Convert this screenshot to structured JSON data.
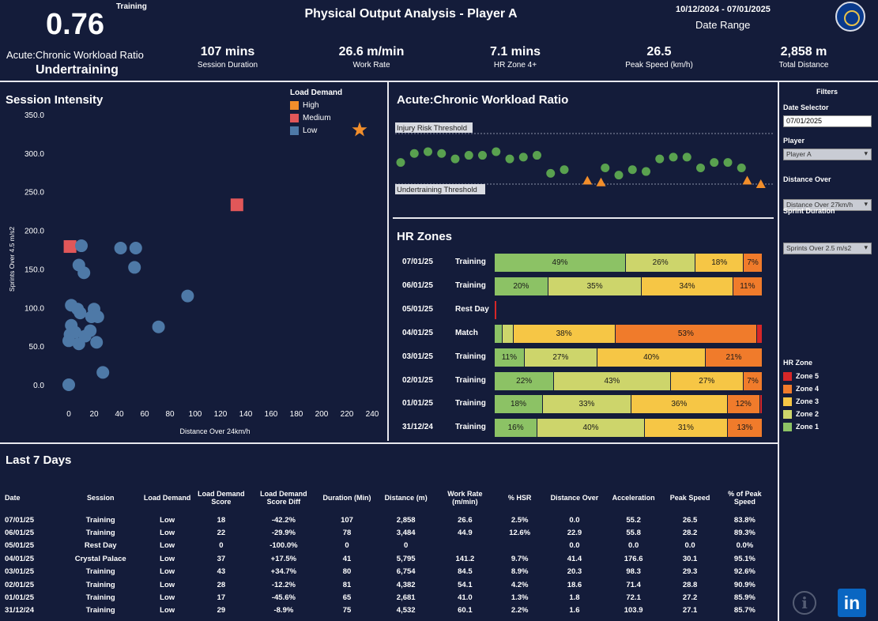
{
  "header": {
    "acwr_value": "0.76",
    "acwr_session": "Training",
    "acwr_label": "Acute:Chronic Workload Ratio",
    "acwr_status": "Undertraining",
    "title": "Physical Output Analysis - Player A",
    "date_range": "10/12/2024 - 07/01/2025",
    "date_range_label": "Date Range",
    "kpis": [
      {
        "value": "107 mins",
        "label": "Session Duration"
      },
      {
        "value": "26.6 m/min",
        "label": "Work Rate"
      },
      {
        "value": "7.1 mins",
        "label": "HR Zone 4+"
      },
      {
        "value": "26.5",
        "label": "Peak Speed (km/h)"
      },
      {
        "value": "2,858 m",
        "label": "Total Distance"
      }
    ]
  },
  "session_intensity": {
    "title": "Session Intensity",
    "legend_title": "Load Demand",
    "legend": [
      {
        "label": "High",
        "color": "#f28e2b"
      },
      {
        "label": "Medium",
        "color": "#e15759"
      },
      {
        "label": "Low",
        "color": "#4e79a7"
      }
    ]
  },
  "chart_data": [
    {
      "type": "scatter",
      "title": "Session Intensity",
      "xlabel": "Distance Over 24km/h",
      "ylabel": "Sprints Over 4.5 m/s2",
      "xlim": [
        -5,
        240
      ],
      "ylim": [
        -10,
        360
      ],
      "x_ticks": [
        "0",
        "20",
        "40",
        "60",
        "80",
        "100",
        "120",
        "140",
        "160",
        "180",
        "200",
        "220",
        "240"
      ],
      "y_ticks": [
        "0.0",
        "50.0",
        "100.0",
        "150.0",
        "200.0",
        "250.0",
        "300.0",
        "350.0"
      ],
      "series": [
        {
          "name": "High",
          "color": "#f28e2b",
          "marker": "star",
          "points": [
            [
              230,
              330
            ]
          ]
        },
        {
          "name": "Medium",
          "color": "#e15759",
          "marker": "square",
          "points": [
            [
              133,
              233
            ],
            [
              1,
              179
            ]
          ]
        },
        {
          "name": "Low",
          "color": "#4e79a7",
          "marker": "circle",
          "points": [
            [
              10,
              180
            ],
            [
              41,
              177
            ],
            [
              53,
              177
            ],
            [
              8,
              155
            ],
            [
              12,
              145
            ],
            [
              52,
              152
            ],
            [
              94,
              115
            ],
            [
              2,
              103
            ],
            [
              7,
              98
            ],
            [
              20,
              98
            ],
            [
              9,
              93
            ],
            [
              23,
              88
            ],
            [
              18,
              88
            ],
            [
              2,
              77
            ],
            [
              71,
              75
            ],
            [
              1,
              65
            ],
            [
              17,
              70
            ],
            [
              5,
              68
            ],
            [
              13,
              63
            ],
            [
              0,
              57
            ],
            [
              22,
              55
            ],
            [
              8,
              53
            ],
            [
              27,
              16
            ],
            [
              0,
              0
            ]
          ]
        }
      ]
    },
    {
      "type": "scatter",
      "title": "Acute:Chronic Workload Ratio",
      "annotations": [
        "Injury Risk Threshold",
        "Undertraining Threshold"
      ],
      "series": [
        {
          "name": "Normal",
          "color": "#59a14f",
          "marker": "circle",
          "values": [
            0.96,
            1.01,
            1.02,
            1.01,
            0.98,
            1.0,
            1.0,
            1.02,
            0.98,
            0.99,
            1.0,
            0.9,
            0.92,
            0.86,
            0.85,
            0.93,
            0.89,
            0.92,
            0.91,
            0.98,
            0.99,
            0.99,
            0.93,
            0.96,
            0.96,
            0.93
          ]
        },
        {
          "name": "Undertraining",
          "color": "#f28e2b",
          "marker": "triangle",
          "indices": [
            13,
            14,
            26,
            27
          ],
          "values": [
            0.86,
            0.85,
            0.86,
            0.84
          ]
        }
      ]
    },
    {
      "type": "bar",
      "title": "HR Zones",
      "stacked": true,
      "categories": [
        "07/01/25",
        "06/01/25",
        "05/01/25",
        "04/01/25",
        "03/01/25",
        "02/01/25",
        "01/01/25",
        "31/12/24"
      ],
      "series": [
        {
          "name": "Zone 1",
          "color": "#8cc265",
          "values": [
            49,
            20,
            0,
            3,
            11,
            22,
            18,
            16
          ]
        },
        {
          "name": "Zone 2",
          "color": "#cdd56b",
          "values": [
            26,
            35,
            0,
            4,
            27,
            43,
            33,
            40
          ]
        },
        {
          "name": "Zone 3",
          "color": "#f6c645",
          "values": [
            18,
            34,
            0,
            38,
            40,
            27,
            36,
            31
          ]
        },
        {
          "name": "Zone 4",
          "color": "#f07b2b",
          "values": [
            7,
            11,
            0,
            53,
            21,
            7,
            12,
            13
          ]
        },
        {
          "name": "Zone 5",
          "color": "#d62728",
          "values": [
            0,
            0,
            0,
            2,
            0,
            0,
            1,
            0
          ]
        }
      ]
    }
  ],
  "acwr_chart": {
    "title": "Acute:Chronic Workload Ratio",
    "injury_label": "Injury Risk Threshold",
    "under_label": "Undertraining Threshold"
  },
  "hr_zones": {
    "title": "HR Zones",
    "legend_title": "HR Zone",
    "legend": [
      {
        "label": "Zone 5",
        "color": "#d62728"
      },
      {
        "label": "Zone 4",
        "color": "#f07b2b"
      },
      {
        "label": "Zone 3",
        "color": "#f6c645"
      },
      {
        "label": "Zone 2",
        "color": "#cdd56b"
      },
      {
        "label": "Zone 1",
        "color": "#8cc265"
      }
    ],
    "rows": [
      {
        "date": "07/01/25",
        "session": "Training",
        "labels": [
          "49%",
          "26%",
          "18%",
          "7%",
          ""
        ]
      },
      {
        "date": "06/01/25",
        "session": "Training",
        "labels": [
          "20%",
          "35%",
          "34%",
          "11%",
          ""
        ]
      },
      {
        "date": "05/01/25",
        "session": "Rest Day",
        "labels": [
          "",
          "",
          "",
          "",
          ""
        ]
      },
      {
        "date": "04/01/25",
        "session": "Match",
        "labels": [
          "",
          "",
          "38%",
          "53%",
          ""
        ]
      },
      {
        "date": "03/01/25",
        "session": "Training",
        "labels": [
          "11%",
          "27%",
          "40%",
          "21%",
          ""
        ]
      },
      {
        "date": "02/01/25",
        "session": "Training",
        "labels": [
          "22%",
          "43%",
          "27%",
          "7%",
          ""
        ]
      },
      {
        "date": "01/01/25",
        "session": "Training",
        "labels": [
          "18%",
          "33%",
          "36%",
          "12%",
          ""
        ]
      },
      {
        "date": "31/12/24",
        "session": "Training",
        "labels": [
          "16%",
          "40%",
          "31%",
          "13%",
          ""
        ]
      }
    ]
  },
  "filters": {
    "title": "Filters",
    "date_label": "Date Selector",
    "date_value": "07/01/2025",
    "player_label": "Player",
    "player_value": "Player A",
    "distance_label": "Distance Over",
    "distance_value": "Distance Over 27km/h",
    "sprint_label": "Sprint Duration",
    "sprint_value": "Sprints Over 2.5 m/s2"
  },
  "last7": {
    "title": "Last 7 Days",
    "columns": [
      "Date",
      "Session",
      "Load Demand",
      "Load Demand Score",
      "Load Demand Score Diff",
      "Duration (Min)",
      "Distance (m)",
      "Work Rate (m/min)",
      "% HSR",
      "Distance Over",
      "Acceleration",
      "Peak Speed",
      "% of Peak Speed"
    ],
    "rows": [
      [
        "07/01/25",
        "Training",
        "Low",
        "18",
        "-42.2%",
        "107",
        "2,858",
        "26.6",
        "2.5%",
        "0.0",
        "55.2",
        "26.5",
        "83.8%"
      ],
      [
        "06/01/25",
        "Training",
        "Low",
        "22",
        "-29.9%",
        "78",
        "3,484",
        "44.9",
        "12.6%",
        "22.9",
        "55.8",
        "28.2",
        "89.3%"
      ],
      [
        "05/01/25",
        "Rest Day",
        "Low",
        "0",
        "-100.0%",
        "0",
        "0",
        "",
        "",
        "0.0",
        "0.0",
        "0.0",
        "0.0%"
      ],
      [
        "04/01/25",
        "Crystal Palace",
        "Low",
        "37",
        "+17.5%",
        "41",
        "5,795",
        "141.2",
        "9.7%",
        "41.4",
        "176.6",
        "30.1",
        "95.1%"
      ],
      [
        "03/01/25",
        "Training",
        "Low",
        "43",
        "+34.7%",
        "80",
        "6,754",
        "84.5",
        "8.9%",
        "20.3",
        "98.3",
        "29.3",
        "92.6%"
      ],
      [
        "02/01/25",
        "Training",
        "Low",
        "28",
        "-12.2%",
        "81",
        "4,382",
        "54.1",
        "4.2%",
        "18.6",
        "71.4",
        "28.8",
        "90.9%"
      ],
      [
        "01/01/25",
        "Training",
        "Low",
        "17",
        "-45.6%",
        "65",
        "2,681",
        "41.0",
        "1.3%",
        "1.8",
        "72.1",
        "27.2",
        "85.9%"
      ],
      [
        "31/12/24",
        "Training",
        "Low",
        "29",
        "-8.9%",
        "75",
        "4,532",
        "60.1",
        "2.2%",
        "1.6",
        "103.9",
        "27.1",
        "85.7%"
      ]
    ]
  }
}
